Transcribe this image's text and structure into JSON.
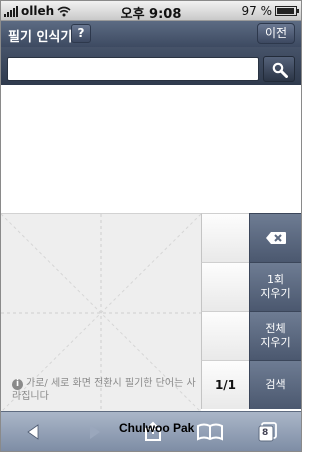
{
  "status_bar": {
    "carrier": "olleh",
    "time": "오후 9:08",
    "battery_percent": "97 %",
    "battery_level": 0.97
  },
  "nav_bar": {
    "title": "필기 인식기",
    "help_label": "?",
    "prev_label": "이전"
  },
  "search": {
    "value": "",
    "placeholder": ""
  },
  "pad": {
    "hint": "가로/ 세로 화면 전환시 필기한 단어는 사라집니다"
  },
  "candidates": {
    "page_indicator": "1/1"
  },
  "actions": {
    "delete_icon": "backspace-icon",
    "undo_label": "1회\n지우기",
    "clear_label": "전체\n지우기",
    "search_label": "검색"
  },
  "toolbar": {
    "tabs_count": "8",
    "watermark": "Chulwoo Pak"
  },
  "colors": {
    "nav_bar": "#4a576e",
    "action_button": "#5d6a81",
    "pad_background": "#eeeeee",
    "toolbar": "#94a1b7"
  }
}
